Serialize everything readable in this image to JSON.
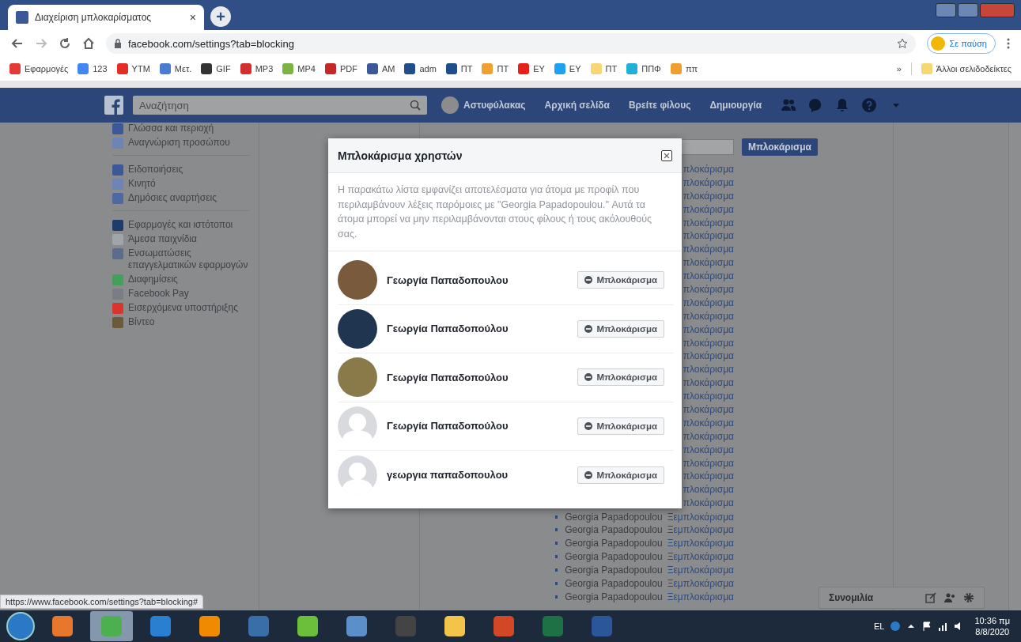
{
  "browser": {
    "tab": {
      "title": "Διαχείριση μπλοκαρίσματος",
      "close": "×",
      "selected": true
    },
    "new_tab": "+",
    "url": "facebook.com/settings?tab=blocking",
    "profile": "Σε παύση",
    "bookmarks": [
      {
        "label": "Εφαρμογές",
        "color": "#e53935"
      },
      {
        "label": "123",
        "color": "#4285f4"
      },
      {
        "label": "YTM",
        "color": "#e52d27"
      },
      {
        "label": "Μετ.",
        "color": "#4a7bd0"
      },
      {
        "label": "GIF",
        "color": "#333333"
      },
      {
        "label": "MP3",
        "color": "#d32f2f"
      },
      {
        "label": "MP4",
        "color": "#7cb342"
      },
      {
        "label": "PDF",
        "color": "#c62828"
      },
      {
        "label": "AM",
        "color": "#3b5998"
      },
      {
        "label": "adm",
        "color": "#1e4f8a"
      },
      {
        "label": "ΠΤ",
        "color": "#1e4f8a"
      },
      {
        "label": "ΠΤ",
        "color": "#f0a030"
      },
      {
        "label": "ΕΥ",
        "color": "#e62117"
      },
      {
        "label": "ΕΥ",
        "color": "#1da1f2"
      },
      {
        "label": "ΠΤ",
        "color": "#f7d774"
      },
      {
        "label": "ΠΠΦ",
        "color": "#20b0d8"
      },
      {
        "label": "ππ",
        "color": "#f0a031"
      }
    ],
    "overflow": "»",
    "other_bookmarks": "Άλλοι σελιδοδείκτες"
  },
  "facebook": {
    "search": {
      "placeholder": "Αναζήτηση"
    },
    "nav": [
      "Αστυφύλακας",
      "Αρχική σελίδα",
      "Βρείτε φίλους",
      "Δημιουργία"
    ]
  },
  "sidebar": {
    "groups": [
      [
        {
          "label": "Γλώσσα και περιοχή",
          "color": "#3b5998"
        },
        {
          "label": "Αναγνώριση προσώπου",
          "color": "#6d84b4"
        }
      ],
      [
        {
          "label": "Ειδοποιήσεις",
          "color": "#3b5998"
        },
        {
          "label": "Κινητό",
          "color": "#6d84b5"
        },
        {
          "label": "Δημόσιες αναρτήσεις",
          "color": "#4e69a2"
        }
      ],
      [
        {
          "label": "Εφαρμογές και ιστότοποι",
          "color": "#1d3b6b"
        },
        {
          "label": "Άμεσα παιχνίδια",
          "color": "#a0a4ab"
        },
        {
          "label": "Ενσωματώσεις επαγγελματικών εφαρμογών",
          "color": "#5b6c8c"
        },
        {
          "label": "Διαφημίσεις",
          "color": "#42a05a"
        },
        {
          "label": "Facebook Pay",
          "color": "#7a7d84"
        },
        {
          "label": "Εισερχόμενα υποστήριξης",
          "color": "#d8352c"
        },
        {
          "label": "Βίντεο",
          "color": "#6b5a3a"
        }
      ]
    ]
  },
  "block_form": {
    "button": "Μπλοκάρισμα"
  },
  "blocked_list": {
    "hidden_rows": [
      "πλοκάρισμα",
      "πλοκάρισμα",
      "πλοκάρισμα",
      "πλοκάρισμα",
      "πλοκάρισμα",
      "πλοκάρισμα",
      "πλοκάρισμα",
      "πλοκάρισμα",
      "πλοκάρισμα",
      "πλοκάρισμα",
      "πλοκάρισμα",
      "πλοκάρισμα",
      "πλοκάρισμα",
      "πλοκάρισμα",
      "πλοκάρισμα",
      "πλοκάρισμα",
      "πλοκάρισμα",
      "πλοκάρισμα",
      "πλοκάρισμα",
      "πλοκάρισμα",
      "πλοκάρισμα",
      "πλοκάρισμα",
      "πλοκάρισμα",
      "πλοκάρισμα",
      "πλοκάρισμα",
      "πλοκάρισμα"
    ],
    "rows": [
      {
        "name": "Georgia Papadopoulou",
        "action": "Ξεμπλοκάρισμα"
      },
      {
        "name": "Georgia Papadopoulou",
        "action": "Ξεμπλοκάρισμα"
      },
      {
        "name": "Georgia Papadopoulou",
        "action": "Ξεμπλοκάρισμα"
      },
      {
        "name": "Georgia Papadopoulou",
        "action": "Ξεμπλοκάρισμα"
      },
      {
        "name": "Georgia Papadopoulou",
        "action": "Ξεμπλοκάρισμα"
      },
      {
        "name": "Georgia Papadopoulou",
        "action": "Ξεμπλοκάρισμα"
      },
      {
        "name": "Georgia Papadopoulou",
        "action": "Ξεμπλοκάρισμα"
      }
    ]
  },
  "dialog": {
    "title": "Μπλοκάρισμα χρηστών",
    "description": "Η παρακάτω λίστα εμφανίζει αποτελέσματα για άτομα με προφίλ που περιλαμβάνουν λέξεις παρόμοιες με \"Georgia Papadopoulou.\" Αυτά τα άτομα μπορεί να μην περιλαμβάνονται στους φίλους ή τους ακόλουθούς σας.",
    "people": [
      {
        "name": "Γεωργία Παπαδοπουλου",
        "kind": "photo",
        "color": "#7a5a3c",
        "button": "Μπλοκάρισμα"
      },
      {
        "name": "Γεωργία Παπαδοπούλου",
        "kind": "photo",
        "color": "#1f3550",
        "button": "Μπλοκάρισμα"
      },
      {
        "name": "Γεωργία Παπαδοπούλου",
        "kind": "photo",
        "color": "#8a7a4a",
        "button": "Μπλοκάρισμα"
      },
      {
        "name": "Γεωργία Παπαδοπούλου",
        "kind": "silhouette",
        "color": "#d8dade",
        "button": "Μπλοκάρισμα"
      },
      {
        "name": "γεωργια παπαδοπουλου",
        "kind": "silhouette",
        "color": "#d8dadf",
        "button": "Μπλοκάρισμα"
      }
    ]
  },
  "chat": {
    "label": "Συνομιλία"
  },
  "status_url": "https://www.facebook.com/settings?tab=blocking#",
  "taskbar": {
    "apps": [
      {
        "color": "#e8772e",
        "active": false
      },
      {
        "color": "#4caf50",
        "active": true
      },
      {
        "color": "#2a7fd0",
        "active": false
      },
      {
        "color": "#f08a00",
        "active": false
      },
      {
        "color": "#3a6ea8",
        "active": false
      },
      {
        "color": "#6cbf3a",
        "active": false
      },
      {
        "color": "#5b8fc9",
        "active": false
      },
      {
        "color": "#444444",
        "active": false
      },
      {
        "color": "#f3c44a",
        "active": false
      },
      {
        "color": "#d24726",
        "active": false
      },
      {
        "color": "#1e7145",
        "active": false
      },
      {
        "color": "#2b579a",
        "active": false
      }
    ],
    "language": "EL",
    "time": "10:36 πμ",
    "date": "8/8/2020"
  }
}
